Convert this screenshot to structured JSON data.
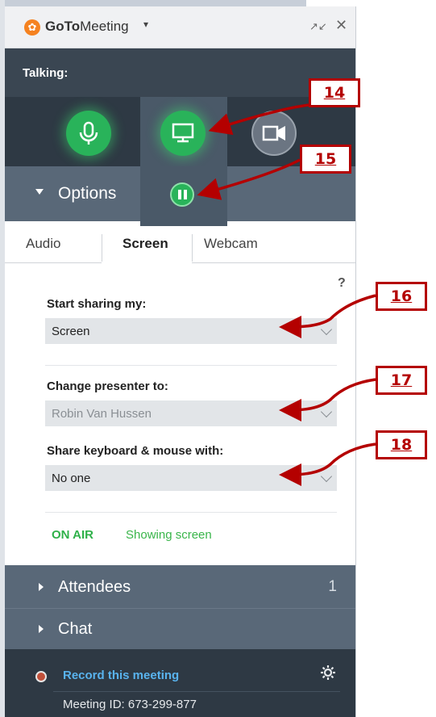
{
  "window": {
    "app_name_bold": "GoTo",
    "app_name_rest": "Meeting",
    "app_caret": "▾",
    "minimize_glyph": "↗↙",
    "close_glyph": "✕"
  },
  "talking": {
    "label": "Talking:"
  },
  "controls": [
    {
      "name": "microphone",
      "state": "on",
      "color": "#29b35a"
    },
    {
      "name": "screen-share",
      "state": "on",
      "color": "#29b35a"
    },
    {
      "name": "webcam",
      "state": "off",
      "color": "#6b7582"
    }
  ],
  "options": {
    "label": "Options",
    "expanded": true
  },
  "tabs": [
    {
      "label": "Audio",
      "active": false
    },
    {
      "label": "Screen",
      "active": true
    },
    {
      "label": "Webcam",
      "active": false
    }
  ],
  "help": "?",
  "fields": {
    "start_sharing": {
      "label": "Start sharing my:",
      "value": "Screen"
    },
    "change_presenter": {
      "label": "Change presenter to:",
      "value": "Robin Van Hussen"
    },
    "share_keyboard": {
      "label": "Share keyboard & mouse with:",
      "value": "No one"
    }
  },
  "status": {
    "on_air": "ON AIR",
    "showing": "Showing screen"
  },
  "attendees": {
    "label": "Attendees",
    "count": "1"
  },
  "chat": {
    "label": "Chat"
  },
  "footer": {
    "record_label": "Record this meeting",
    "meeting_id": "Meeting ID: 673-299-877"
  },
  "callouts": [
    "14",
    "15",
    "16",
    "17",
    "18"
  ],
  "colors": {
    "accent_green": "#29b35a",
    "callout_red": "#b40000",
    "panel_dark": "#2e3944",
    "section_bar": "#596878",
    "link_blue": "#59b3ee"
  }
}
